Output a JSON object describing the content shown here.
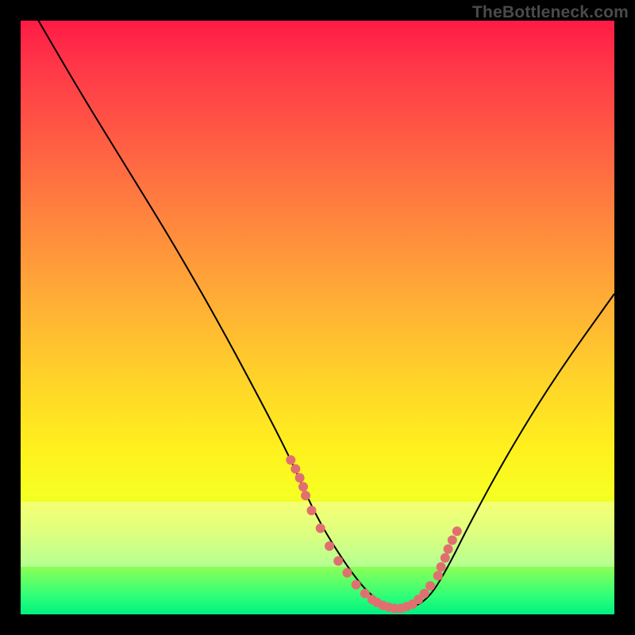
{
  "watermark": {
    "text": "TheBottleneck.com"
  },
  "chart_data": {
    "type": "line",
    "title": "",
    "xlabel": "",
    "ylabel": "",
    "xlim": [
      0,
      100
    ],
    "ylim": [
      0,
      100
    ],
    "background": {
      "gradient_top_color": "#ff1b46",
      "gradient_bottom_color": "#00f080",
      "pale_band_y": [
        8,
        19
      ]
    },
    "series": [
      {
        "name": "main-curve",
        "color": "#000000",
        "x": [
          3,
          10,
          18,
          26,
          34,
          42,
          46,
          50,
          55,
          59,
          63,
          66,
          69,
          72,
          76,
          82,
          90,
          100
        ],
        "y": [
          100,
          88,
          75,
          62,
          48,
          33,
          25,
          16,
          8,
          3,
          1,
          1,
          3,
          8,
          16,
          27,
          40,
          54
        ]
      },
      {
        "name": "highlight-dots",
        "color": "#e07070",
        "type": "scatter",
        "x": [
          45.5,
          46.3,
          47.0,
          47.6,
          48.0,
          49.0,
          50.5,
          52.0,
          53.5,
          55.0,
          56.5,
          58.0,
          59.2,
          60.0,
          61.0,
          62.0,
          63.0,
          64.0,
          65.0,
          66.0,
          67.0,
          68.0,
          69.0,
          70.3,
          70.8,
          71.5,
          72.0,
          72.7,
          73.5
        ],
        "y": [
          26,
          24.5,
          23,
          21.5,
          20,
          17.5,
          14.5,
          11.5,
          9,
          7,
          5,
          3.5,
          2.5,
          2,
          1.5,
          1.2,
          1,
          1,
          1.3,
          1.7,
          2.5,
          3.5,
          4.8,
          6.5,
          8,
          9.5,
          11,
          12.5,
          14
        ]
      }
    ]
  }
}
